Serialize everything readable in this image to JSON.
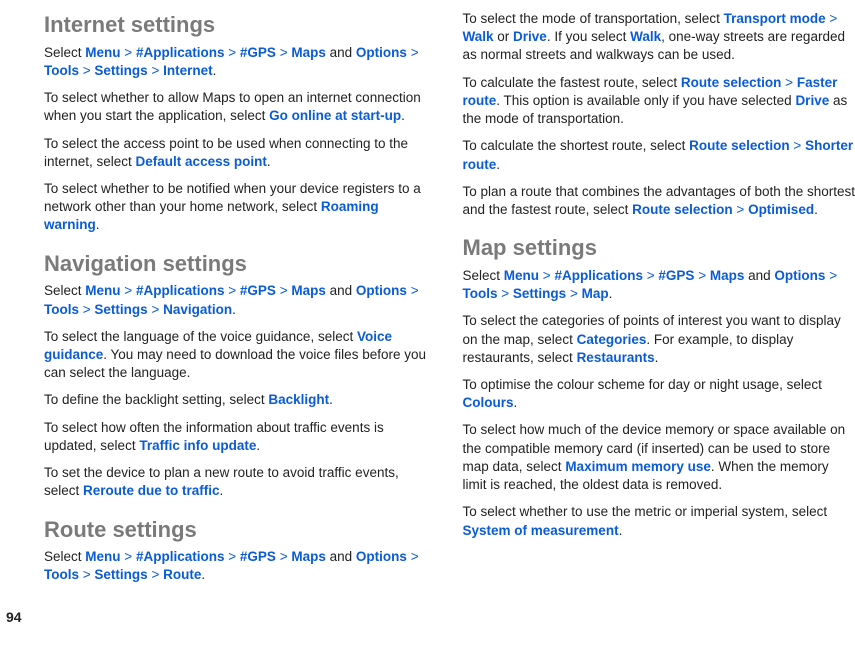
{
  "page_number": "94",
  "h_internet": "Internet settings",
  "h_navigation": "Navigation settings",
  "h_route": "Route settings",
  "h_map": "Map settings",
  "nav": {
    "menu": "Menu",
    "apps": "#Applications",
    "gps": "#GPS",
    "maps": "Maps",
    "options": "Options",
    "tools": "Tools",
    "settings": "Settings",
    "gt": ">",
    "and": "and"
  },
  "internet": {
    "leaf": "Internet",
    "p2a": "To select whether to allow Maps to open an internet connection when you start the application, select ",
    "p2b": "Go online at start-up",
    "p3a": "To select the access point to be used when connecting to the internet, select ",
    "p3b": "Default access point",
    "p4a": "To select whether to be notified when your device registers to a network other than your home network, select ",
    "p4b": "Roaming warning"
  },
  "navigation": {
    "leaf": "Navigation",
    "p2a": "To select the language of the voice guidance, select ",
    "p2b": "Voice guidance",
    "p2c": ". You may need to download the voice files before you can select the language.",
    "p3a": "To define the backlight setting, select ",
    "p3b": "Backlight",
    "p4a": "To select how often the information about traffic events is updated, select ",
    "p4b": "Traffic info update",
    "p5a": "To set the device to plan a new route to avoid traffic events, select ",
    "p5b": "Reroute due to traffic"
  },
  "route": {
    "leaf": "Route",
    "p2a": "To select the mode of transportation, select ",
    "p2b": "Transport mode",
    "p2c": "Walk",
    "p2d": " or ",
    "p2e": "Drive",
    "p2f": ". If you select ",
    "p2g": "Walk",
    "p2h": ", one-way streets are regarded as normal streets and walkways can be used.",
    "p3a": "To calculate the fastest route, select ",
    "p3b": "Route selection",
    "p3c": "Faster route",
    "p3d": ". This option is available only if you have selected ",
    "p3e": "Drive",
    "p3f": " as the mode of transportation.",
    "p4a": "To calculate the shortest route, select ",
    "p4b": "Route selection",
    "p4c": "Shorter route",
    "p5a": "To plan a route that combines the advantages of both the shortest and the fastest route, select ",
    "p5b": "Route selection",
    "p5c": "Optimised"
  },
  "map": {
    "leaf": "Map",
    "p2a": "To select the categories of points of interest you want to display on the map, select ",
    "p2b": "Categories",
    "p2c": ". For example, to display restaurants, select ",
    "p2d": "Restaurants",
    "p3a": "To optimise the colour scheme for day or night usage, select ",
    "p3b": "Colours",
    "p4a": "To select how much of the device memory or space available on the compatible memory card (if inserted) can be used to store map data, select ",
    "p4b": "Maximum memory use",
    "p4c": ". When the memory limit is reached, the oldest data is removed.",
    "p5a": "To select whether to use the metric or imperial system, select ",
    "p5b": "System of measurement"
  },
  "select": "Select ",
  "period": "."
}
